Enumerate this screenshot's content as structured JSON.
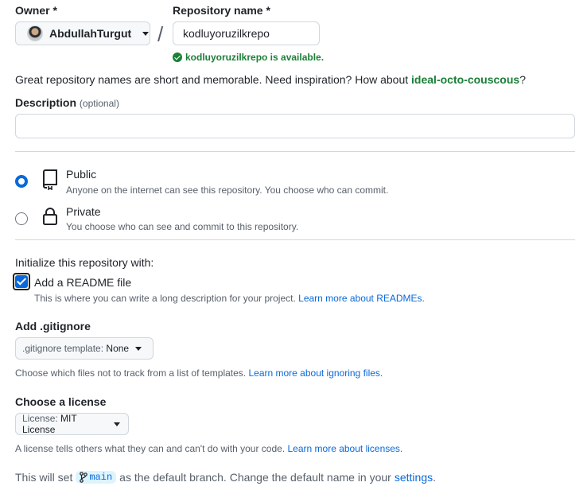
{
  "owner": {
    "label": "Owner",
    "required": "*",
    "name": "AbdullahTurgut"
  },
  "repo": {
    "label": "Repository name",
    "required": "*",
    "value": "kodluyoruzilkrepo",
    "available": "kodluyoruzilkrepo is available.",
    "separator": "/"
  },
  "hint": {
    "text": "Great repository names are short and memorable. Need inspiration? How about ",
    "suggestion": "ideal-octo-couscous",
    "end": "?"
  },
  "description": {
    "label": "Description",
    "optional": "(optional)",
    "value": ""
  },
  "visibility": {
    "public": {
      "title": "Public",
      "sub": "Anyone on the internet can see this repository. You choose who can commit."
    },
    "private": {
      "title": "Private",
      "sub": "You choose who can see and commit to this repository."
    },
    "selected": "public"
  },
  "init": {
    "heading": "Initialize this repository with:",
    "readme_label": "Add a README file",
    "readme_checked": true,
    "readme_help": "This is where you can write a long description for your project. ",
    "readme_link": "Learn more about READMEs."
  },
  "gitignore": {
    "heading": "Add .gitignore",
    "key": ".gitignore template:",
    "value": "None",
    "help": "Choose which files not to track from a list of templates. ",
    "link": "Learn more about ignoring files."
  },
  "license": {
    "heading": "Choose a license",
    "key": "License:",
    "value": "MIT License",
    "help": "A license tells others what they can and can't do with your code. ",
    "link": "Learn more about licenses."
  },
  "footer": {
    "pre": "This will set",
    "branch": "main",
    "mid": "as the default branch. Change the default name in your",
    "link": "settings",
    "end": "."
  },
  "colors": {
    "accent": "#0969da",
    "success": "#1a7f37",
    "muted": "#57606a"
  }
}
